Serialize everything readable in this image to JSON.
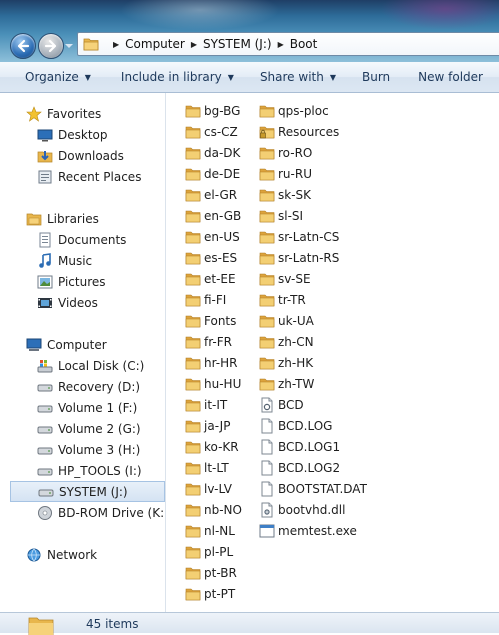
{
  "breadcrumb": [
    "Computer",
    "SYSTEM (J:)",
    "Boot"
  ],
  "toolbar": {
    "organize": "Organize",
    "include_in_library": "Include in library",
    "share_with": "Share with",
    "burn": "Burn",
    "new_folder": "New folder"
  },
  "nav": {
    "favorites": {
      "label": "Favorites",
      "items": [
        "Desktop",
        "Downloads",
        "Recent Places"
      ]
    },
    "libraries": {
      "label": "Libraries",
      "items": [
        "Documents",
        "Music",
        "Pictures",
        "Videos"
      ]
    },
    "computer": {
      "label": "Computer",
      "items": [
        "Local Disk (C:)",
        "Recovery (D:)",
        "Volume 1 (F:)",
        "Volume 2 (G:)",
        "Volume 3 (H:)",
        "HP_TOOLS (I:)",
        "SYSTEM (J:)",
        "BD-ROM Drive (K:) E"
      ]
    },
    "network": {
      "label": "Network"
    },
    "selected": "SYSTEM (J:)"
  },
  "files_col1": [
    "bg-BG",
    "cs-CZ",
    "da-DK",
    "de-DE",
    "el-GR",
    "en-GB",
    "en-US",
    "es-ES",
    "et-EE",
    "fi-FI",
    "Fonts",
    "fr-FR",
    "hr-HR",
    "hu-HU",
    "it-IT",
    "ja-JP",
    "ko-KR",
    "lt-LT",
    "lv-LV",
    "nb-NO",
    "nl-NL",
    "pl-PL",
    "pt-BR",
    "pt-PT"
  ],
  "files_col2": [
    {
      "name": "qps-ploc",
      "icon": "folder-icon"
    },
    {
      "name": "Resources",
      "icon": "locked-folder-icon"
    },
    {
      "name": "ro-RO",
      "icon": "folder-icon"
    },
    {
      "name": "ru-RU",
      "icon": "folder-icon"
    },
    {
      "name": "sk-SK",
      "icon": "folder-icon"
    },
    {
      "name": "sl-SI",
      "icon": "folder-icon"
    },
    {
      "name": "sr-Latn-CS",
      "icon": "folder-icon"
    },
    {
      "name": "sr-Latn-RS",
      "icon": "folder-icon"
    },
    {
      "name": "sv-SE",
      "icon": "folder-icon"
    },
    {
      "name": "tr-TR",
      "icon": "folder-icon"
    },
    {
      "name": "uk-UA",
      "icon": "folder-icon"
    },
    {
      "name": "zh-CN",
      "icon": "folder-icon"
    },
    {
      "name": "zh-HK",
      "icon": "folder-icon"
    },
    {
      "name": "zh-TW",
      "icon": "folder-icon"
    },
    {
      "name": "BCD",
      "icon": "system-file-icon"
    },
    {
      "name": "BCD.LOG",
      "icon": "file-icon"
    },
    {
      "name": "BCD.LOG1",
      "icon": "file-icon"
    },
    {
      "name": "BCD.LOG2",
      "icon": "file-icon"
    },
    {
      "name": "BOOTSTAT.DAT",
      "icon": "file-icon"
    },
    {
      "name": "bootvhd.dll",
      "icon": "dll-file-icon"
    },
    {
      "name": "memtest.exe",
      "icon": "exe-file-icon"
    }
  ],
  "status": {
    "count": "45 items"
  }
}
